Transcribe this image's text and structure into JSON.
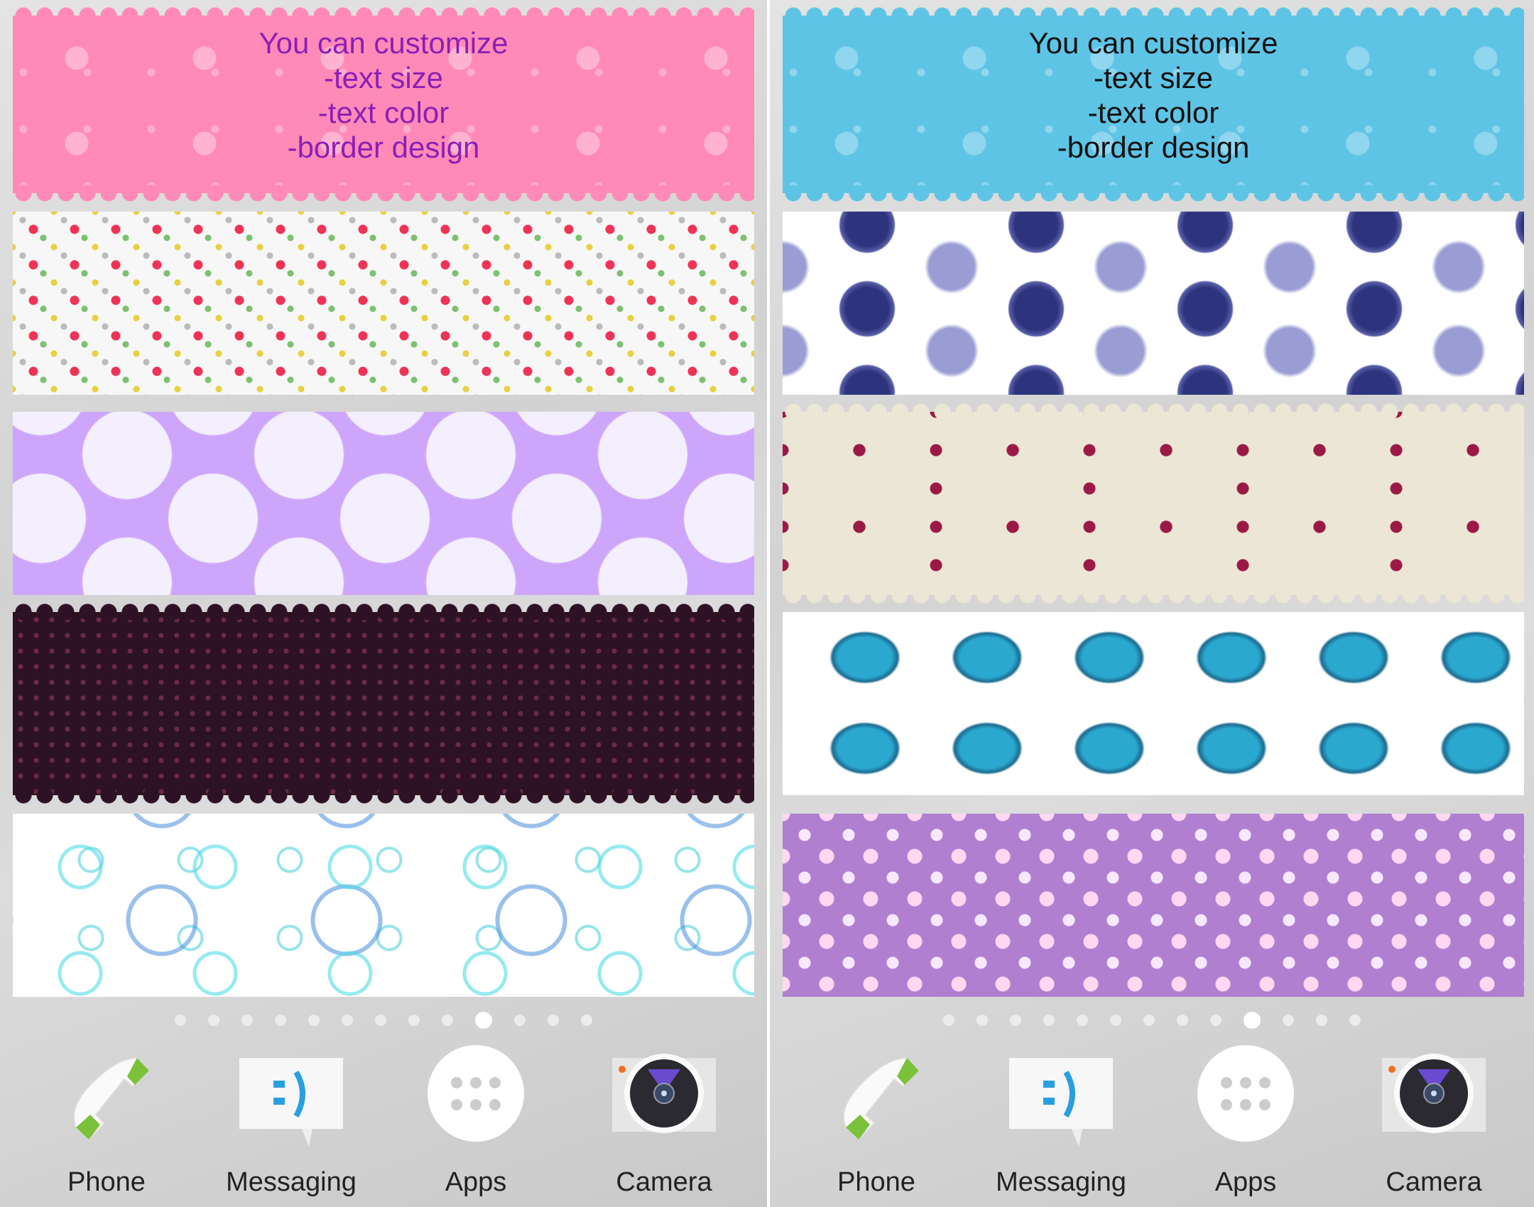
{
  "panels": [
    {
      "banner_text": [
        "You can customize",
        "-text size",
        "-text color",
        "-border design"
      ],
      "pattern_colors": [
        "#ff8ab8",
        "#f7f7f7",
        "#cda6fb",
        "#2d1124",
        "#ffffff"
      ],
      "text_color": "#8c1fb4"
    },
    {
      "banner_text": [
        "You can customize",
        "-text size",
        "-text color",
        "-border design"
      ],
      "pattern_colors": [
        "#5ec4e6",
        "#ffffff",
        "#ece6d6",
        "#ffffff",
        "#b07fd0"
      ],
      "text_color": "#111111"
    }
  ],
  "page_indicator": {
    "count": 13,
    "active_index": 9
  },
  "dock": [
    {
      "label": "Phone",
      "icon": "phone-icon"
    },
    {
      "label": "Messaging",
      "icon": "messaging-icon"
    },
    {
      "label": "Apps",
      "icon": "apps-grid-icon"
    },
    {
      "label": "Camera",
      "icon": "camera-icon"
    }
  ]
}
